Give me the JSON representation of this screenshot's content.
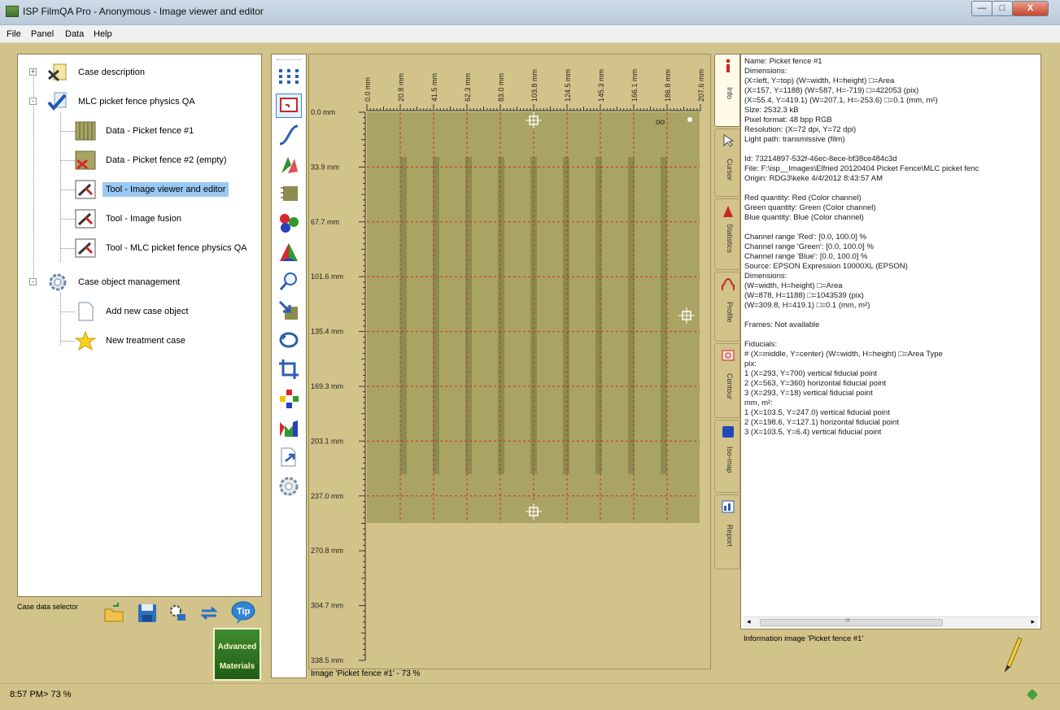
{
  "window": {
    "title": "ISP FilmQA Pro - Anonymous - Image viewer and editor",
    "controls": {
      "minimize": "—",
      "maximize": "□",
      "close": "X"
    }
  },
  "menu": [
    "File",
    "Panel",
    "Data",
    "Help"
  ],
  "tree": {
    "items": [
      {
        "label": "Case description",
        "icon": "case-description-icon"
      },
      {
        "label": "MLC picket fence physics QA",
        "icon": "checkmark-icon"
      },
      {
        "label": "Data - Picket fence #1",
        "icon": "film-thumbnail-icon"
      },
      {
        "label": "Data - Picket fence #2 (empty)",
        "icon": "film-empty-icon"
      },
      {
        "label": "Tool - Image viewer and editor",
        "icon": "tool-icon",
        "selected": true
      },
      {
        "label": "Tool - Image fusion",
        "icon": "tool-icon"
      },
      {
        "label": "Tool - MLC picket fence physics QA",
        "icon": "tool-icon"
      },
      {
        "label": "Case object management",
        "icon": "gear-icon"
      },
      {
        "label": "Add new case object",
        "icon": "document-icon"
      },
      {
        "label": "New treatment case",
        "icon": "star-icon"
      }
    ]
  },
  "case_selector": {
    "label": "Case data selector",
    "buttons": [
      "open-folder-icon",
      "save-icon",
      "settings-icon",
      "swap-icon",
      "tip-icon"
    ],
    "tip_text": "Tip"
  },
  "logo": {
    "line1": "Advanced",
    "line2": "Materials"
  },
  "tools": [
    "grid-points-icon",
    "roi-frame-icon",
    "curve-icon",
    "color-picker-icon",
    "channel-icon",
    "rgb-balls-icon",
    "pyramid-icon",
    "magnifier-icon",
    "import-icon",
    "rotate-icon",
    "crop-icon",
    "color-dots-icon",
    "rainbow-icon",
    "export-icon",
    "gear-icon"
  ],
  "viewer": {
    "x_ticks": [
      "0.0 mm",
      "20.8 mm",
      "41.5 mm",
      "62.3 mm",
      "83.0 mm",
      "103.8 mm",
      "124.5 mm",
      "145.3 mm",
      "166.1 mm",
      "186.8 mm",
      "207.6 mm"
    ],
    "y_ticks": [
      "0.0 mm",
      "33.9 mm",
      "67.7 mm",
      "101.6 mm",
      "135.4 mm",
      "169.3 mm",
      "203.1 mm",
      "237.0 mm",
      "270.8 mm",
      "304.7 mm",
      "338.5 mm"
    ],
    "corner_mark": "oo",
    "caption": "Image 'Picket fence #1' - 73 %",
    "film_color": "#a9a464",
    "strip_color": "#6f7640",
    "grid_color": "#d8262a"
  },
  "side_tabs": [
    {
      "label": "Info",
      "icon": "info-icon",
      "active": true
    },
    {
      "label": "Cursor",
      "icon": "cursor-icon"
    },
    {
      "label": "Statistics",
      "icon": "statistics-icon"
    },
    {
      "label": "Profile",
      "icon": "profile-icon"
    },
    {
      "label": "Contour",
      "icon": "contour-icon"
    },
    {
      "label": "Iso-map",
      "icon": "isomap-icon"
    },
    {
      "label": "Report",
      "icon": "report-icon"
    }
  ],
  "info_lines": [
    "Name: Picket fence #1",
    "Dimensions:",
    "(X=left, Y=top) (W=width, H=height) □=Area",
    "(X=157, Y=1188) (W=587, H=-719) □=422053  (pix)",
    "(X=55.4, Y=419.1) (W=207.1, H=-253.6) □=0.1  (mm, m²)",
    "Size:  2532.3 kB",
    "Pixel format:  48 bpp RGB",
    "Resolution: (X=72 dpi, Y=72 dpi)",
    "Light path:  transmissive (film)",
    "",
    "Id:  73214897-532f-46ec-8ece-bf38ce484c3d",
    "File: F:\\isp__Images\\Elfried 20120404 Picket Fence\\MLC picket fenc",
    "Origin:  RDG3\\keke 4/4/2012 8:43:57 AM",
    "",
    "Red quantity: Red (Color channel)",
    "Green quantity: Green (Color channel)",
    "Blue quantity: Blue (Color channel)",
    "",
    "Channel range 'Red':  [0.0, 100.0] %",
    "Channel range 'Green':  [0.0, 100.0] %",
    "Channel range 'Blue':  [0.0, 100.0] %",
    "Source:  EPSON Expression 10000XL (EPSON)",
    "Dimensions:",
    "(W=width, H=height) □=Area",
    "(W=878, H=1188) □=1043539  (pix)",
    "(W=309.8, H=419.1) □=0.1  (mm, m²)",
    "",
    "Frames:  Not available",
    "",
    "Fiducials:",
    "# (X=middle, Y=center) (W=width, H=height) □=Area  Type",
    "pix:",
    "1 (X=293, Y=700)  vertical fiducial point",
    "2 (X=563, Y=360)  horizontal fiducial point",
    "3 (X=293, Y=18)  vertical fiducial point",
    "mm, m²:",
    "1 (X=103.5, Y=247.0)  vertical fiducial point",
    "2 (X=198.6, Y=127.1)  horizontal fiducial point",
    "3 (X=103.5, Y=6.4)  vertical fiducial point"
  ],
  "info_scroll": {
    "left_arrow": "◂",
    "right_arrow": "▸",
    "grip": "III"
  },
  "info_caption": "Information image 'Picket fence #1'",
  "status": "8:57 PM> 73 %"
}
